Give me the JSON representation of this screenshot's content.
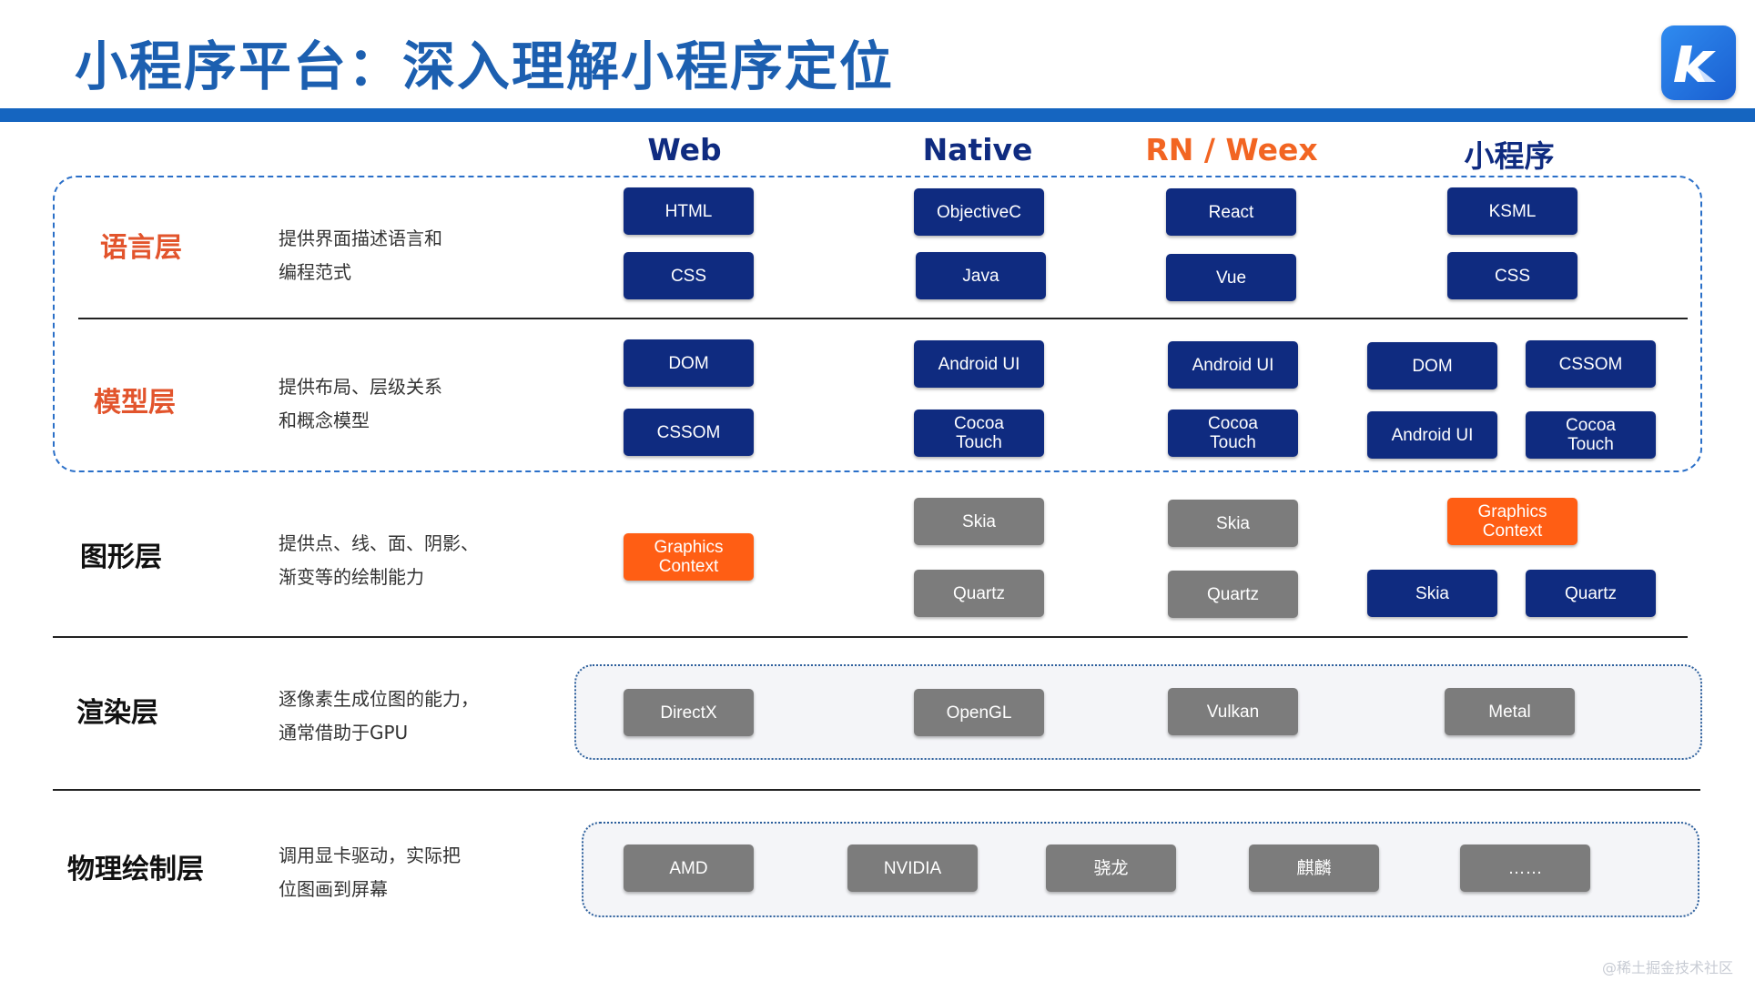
{
  "title": "小程序平台：深入理解小程序定位",
  "columns": [
    {
      "label": "Web",
      "color": "#0f2b80"
    },
    {
      "label": "Native",
      "color": "#0f2b80"
    },
    {
      "label": "RN / Weex",
      "color": "#f26522"
    },
    {
      "label": "小程序",
      "color": "#0f2b80"
    }
  ],
  "layers": [
    {
      "name": "语言层",
      "desc": [
        "提供界面描述语言和",
        "编程范式"
      ]
    },
    {
      "name": "模型层",
      "desc": [
        "提供布局、层级关系",
        "和概念模型"
      ]
    },
    {
      "name": "图形层",
      "desc": [
        "提供点、线、面、阴影、",
        "渐变等的绘制能力"
      ]
    },
    {
      "name": "渲染层",
      "desc": [
        "逐像素生成位图的能力，",
        "通常借助于GPU"
      ]
    },
    {
      "name": "物理绘制层",
      "desc": [
        "调用显卡驱动，实际把",
        "位图画到屏幕"
      ]
    }
  ],
  "boxes": {
    "language": {
      "web": [
        "HTML",
        "CSS"
      ],
      "native": [
        "ObjectiveC",
        "Java"
      ],
      "rn": [
        "React",
        "Vue"
      ],
      "mini": [
        "KSML",
        "CSS"
      ]
    },
    "model": {
      "web": [
        "DOM",
        "CSSOM"
      ],
      "native": [
        "Android UI",
        "Cocoa\nTouch"
      ],
      "rn": [
        "Android UI",
        "Cocoa\nTouch"
      ],
      "mini": [
        "DOM",
        "CSSOM",
        "Android UI",
        "Cocoa\nTouch"
      ]
    },
    "graphics": {
      "web": [
        "Graphics\nContext"
      ],
      "native": [
        "Skia",
        "Quartz"
      ],
      "rn": [
        "Skia",
        "Quartz"
      ],
      "mini": [
        "Graphics\nContext",
        "Skia",
        "Quartz"
      ]
    },
    "render": [
      "DirectX",
      "OpenGL",
      "Vulkan",
      "Metal"
    ],
    "physical": [
      "AMD",
      "NVIDIA",
      "骁龙",
      "麒麟",
      "……"
    ]
  },
  "watermark": "@稀土掘金技术社区"
}
